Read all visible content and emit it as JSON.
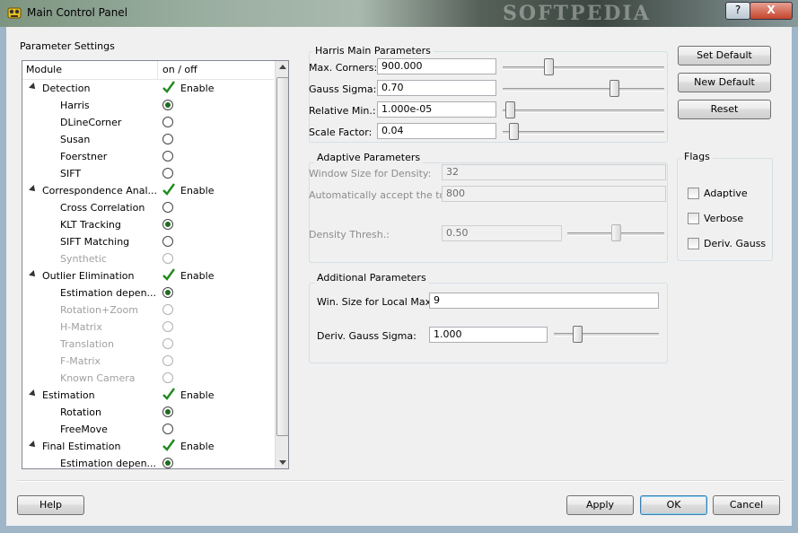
{
  "window": {
    "title": "Main Control Panel",
    "watermark": "SOFTPEDIA",
    "help_button": "?",
    "close_button": "X"
  },
  "param_settings": {
    "title": "Parameter Settings",
    "col_module": "Module",
    "col_onoff": "on / off",
    "rows": [
      {
        "label": "Detection",
        "type": "group",
        "value": "Enable"
      },
      {
        "label": "Harris",
        "type": "radio",
        "selected": true,
        "disabled": false
      },
      {
        "label": "DLineCorner",
        "type": "radio",
        "selected": false,
        "disabled": false
      },
      {
        "label": "Susan",
        "type": "radio",
        "selected": false,
        "disabled": false
      },
      {
        "label": "Foerstner",
        "type": "radio",
        "selected": false,
        "disabled": false
      },
      {
        "label": "SIFT",
        "type": "radio",
        "selected": false,
        "disabled": false
      },
      {
        "label": "Correspondence Anal...",
        "type": "group",
        "value": "Enable"
      },
      {
        "label": "Cross Correlation",
        "type": "radio",
        "selected": false,
        "disabled": false
      },
      {
        "label": "KLT Tracking",
        "type": "radio",
        "selected": true,
        "disabled": false
      },
      {
        "label": "SIFT Matching",
        "type": "radio",
        "selected": false,
        "disabled": false
      },
      {
        "label": "Synthetic",
        "type": "radio",
        "selected": false,
        "disabled": true
      },
      {
        "label": "Outlier Elimination",
        "type": "group",
        "value": "Enable"
      },
      {
        "label": "Estimation depen...",
        "type": "radio",
        "selected": true,
        "disabled": false
      },
      {
        "label": "Rotation+Zoom",
        "type": "radio",
        "selected": false,
        "disabled": true
      },
      {
        "label": "H-Matrix",
        "type": "radio",
        "selected": false,
        "disabled": true
      },
      {
        "label": "Translation",
        "type": "radio",
        "selected": false,
        "disabled": true
      },
      {
        "label": "F-Matrix",
        "type": "radio",
        "selected": false,
        "disabled": true
      },
      {
        "label": "Known Camera",
        "type": "radio",
        "selected": false,
        "disabled": true
      },
      {
        "label": "Estimation",
        "type": "group",
        "value": "Enable"
      },
      {
        "label": "Rotation",
        "type": "radio",
        "selected": true,
        "disabled": false
      },
      {
        "label": "FreeMove",
        "type": "radio",
        "selected": false,
        "disabled": false
      },
      {
        "label": "Final Estimation",
        "type": "group",
        "value": "Enable"
      },
      {
        "label": "Estimation depen...",
        "type": "radio",
        "selected": true,
        "disabled": false
      }
    ]
  },
  "harris": {
    "title": "Harris Main Parameters",
    "max_corners_label": "Max. Corners:",
    "max_corners_value": "900.000",
    "max_corners_slider": 0.27,
    "gauss_sigma_label": "Gauss Sigma:",
    "gauss_sigma_value": "0.70",
    "gauss_sigma_slider": 0.7,
    "relative_min_label": "Relative Min.:",
    "relative_min_value": "1.000e-05",
    "relative_min_slider": 0.02,
    "scale_factor_label": "Scale Factor:",
    "scale_factor_value": "0.04",
    "scale_factor_slider": 0.04
  },
  "adaptive": {
    "title": "Adaptive Parameters",
    "window_size_label": "Window Size for Density:",
    "window_size_value": "32",
    "auto_accept_label": "Automatically accept the top:",
    "auto_accept_value": "800",
    "density_thresh_label": "Density Thresh.:",
    "density_thresh_value": "0.50",
    "density_thresh_slider": 0.5
  },
  "additional": {
    "title": "Additional Parameters",
    "win_size_label": "Win. Size for Local Max:",
    "win_size_value": "9",
    "deriv_sigma_label": "Deriv. Gauss Sigma:",
    "deriv_sigma_value": "1.000",
    "deriv_sigma_slider": 0.2
  },
  "side_buttons": {
    "set_default": "Set Default",
    "new_default": "New Default",
    "reset": "Reset"
  },
  "flags": {
    "title": "Flags",
    "adaptive": "Adaptive",
    "verbose": "Verbose",
    "deriv_gauss": "Deriv. Gauss"
  },
  "bottom": {
    "help": "Help",
    "apply": "Apply",
    "ok": "OK",
    "cancel": "Cancel"
  },
  "colors": {
    "check_green": "#1f8a1f",
    "radio_dot": "#1f6b1f",
    "default_button_border": "#3c7fb1"
  }
}
